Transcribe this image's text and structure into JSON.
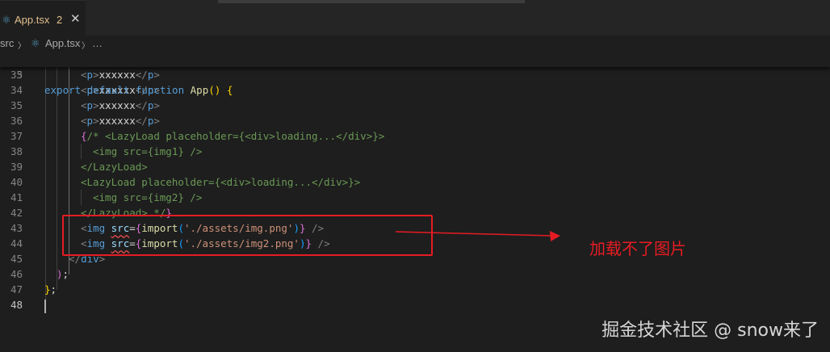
{
  "tab": {
    "icon": "react-icon",
    "name": "App.tsx",
    "problems": "2",
    "close": "✕"
  },
  "breadcrumb": {
    "folder": "src",
    "sep1": "〉",
    "file_icon": "react-icon",
    "file": "App.tsx",
    "sep2": "〉",
    "more": "…"
  },
  "sticky": {
    "number": "5",
    "text": "export default function App() {"
  },
  "lines": [
    {
      "n": "33",
      "text": "<p>xxxxxx</p>"
    },
    {
      "n": "34",
      "text": "<p>xxxxxx</p>"
    },
    {
      "n": "35",
      "text": "<p>xxxxxx</p>"
    },
    {
      "n": "36",
      "text": "<p>xxxxxx</p>"
    },
    {
      "n": "37",
      "text": "{/* <LazyLoad placeholder={<div>loading...</div>}>"
    },
    {
      "n": "38",
      "text": "<img src={img1} />"
    },
    {
      "n": "39",
      "text": "</LazyLoad>"
    },
    {
      "n": "40",
      "text": "<LazyLoad placeholder={<div>loading...</div>}>"
    },
    {
      "n": "41",
      "text": "<img src={img2} />"
    },
    {
      "n": "42",
      "text": "</LazyLoad> */}"
    },
    {
      "n": "43",
      "text": "<img src={import('./assets/img.png')} />"
    },
    {
      "n": "44",
      "text": "<img src={import('./assets/img2.png')} />"
    },
    {
      "n": "45",
      "text": "</div>"
    },
    {
      "n": "46",
      "text": ");"
    },
    {
      "n": "47",
      "text": "};"
    },
    {
      "n": "48",
      "text": ""
    }
  ],
  "annotation": "加载不了图片",
  "watermark": "掘金技术社区 @ snow来了",
  "colors": {
    "annotation_red": "#e51c23",
    "editor_bg": "#1e1e1e",
    "tab_modified": "#e2c08d"
  }
}
